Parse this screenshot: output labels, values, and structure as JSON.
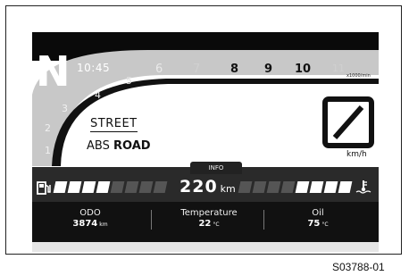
{
  "gear": "N",
  "clock": "10:45",
  "rpm_scale": {
    "dim_labels": [
      "1",
      "2",
      "3",
      "4",
      "5",
      "6",
      "7"
    ],
    "bold_labels": [
      "8",
      "9",
      "10"
    ],
    "redline_label": "11",
    "unit": "x1000/min"
  },
  "riding_mode": "STREET",
  "abs": {
    "label": "ABS",
    "mode": "ROAD"
  },
  "speed": {
    "value": "",
    "unit": "km/h",
    "display_icon": "slash-placeholder-icon"
  },
  "info_tab": "INFO",
  "fuel": {
    "icon": "fuel-pump-icon",
    "filled_segments": 4,
    "total_segments": 8
  },
  "distance": {
    "value": "220",
    "unit": "km"
  },
  "coolant": {
    "icon": "coolant-temperature-icon",
    "filled_segments": 4,
    "total_segments": 8
  },
  "info_fields": [
    {
      "label": "ODO",
      "value": "3874",
      "unit": "km"
    },
    {
      "label": "Temperature",
      "value": "22",
      "unit": "°C"
    },
    {
      "label": "Oil",
      "value": "75",
      "unit": "°C"
    }
  ],
  "figure_ref": "S03788-01",
  "colors": {
    "dark": "#111111",
    "bar": "#2a2a2a",
    "segment_on": "#ffffff",
    "segment_off": "#555555",
    "arc_gray": "#c8c8c8"
  }
}
